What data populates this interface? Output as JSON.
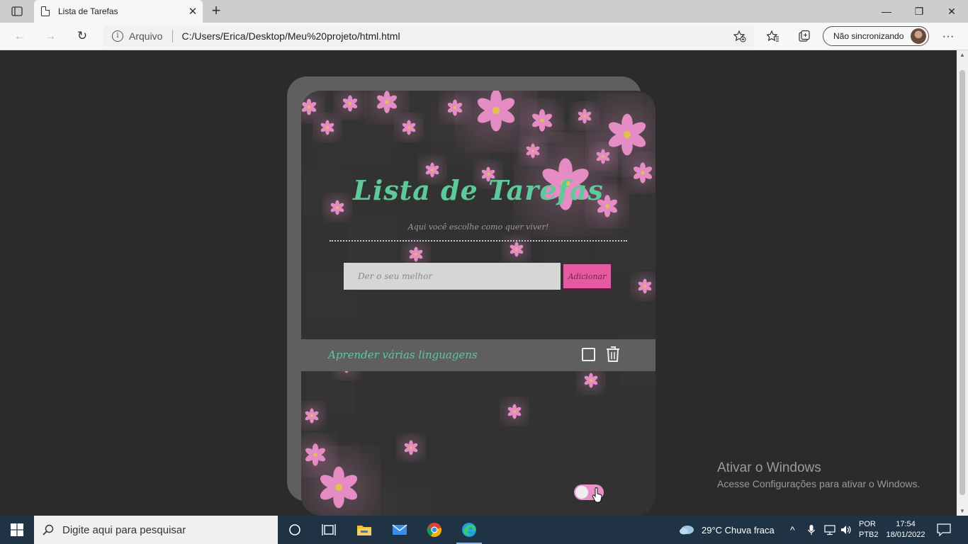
{
  "browser": {
    "tab_title": "Lista de Tarefas",
    "tab_close": "✕",
    "new_tab": "+",
    "address_protocol": "Arquivo",
    "address_url": "C:/Users/Erica/Desktop/Meu%20projeto/html.html",
    "sync_label": "Não sincronizando",
    "window_controls": {
      "minimize": "—",
      "restore": "❐",
      "close": "✕"
    },
    "nav": {
      "back": "←",
      "forward": "→",
      "refresh": "↻",
      "more": "···"
    }
  },
  "app": {
    "title": "Lista de Tarefas",
    "subtitle": "Aqui você escolhe como quer viver!",
    "input_placeholder": "Der o seu melhor",
    "add_button": "Adicionar",
    "tasks": [
      {
        "text": "Aprender várias linguagens",
        "done": false
      }
    ],
    "theme_toggle_on": true,
    "colors": {
      "accent_green": "#5ec99a",
      "accent_pink": "#e55aa0",
      "flower_pink": "#e58cc4"
    }
  },
  "windows_activation": {
    "title": "Ativar o Windows",
    "message": "Acesse Configurações para ativar o Windows."
  },
  "taskbar": {
    "search_placeholder": "Digite aqui para pesquisar",
    "weather": "29°C  Chuva fraca",
    "language_line1": "POR",
    "language_line2": "PTB2",
    "time": "17:54",
    "date": "18/01/2022",
    "pinned_icons": [
      "cortana-icon",
      "task-view-icon",
      "file-explorer-icon",
      "mail-icon",
      "chrome-icon",
      "edge-icon"
    ]
  }
}
